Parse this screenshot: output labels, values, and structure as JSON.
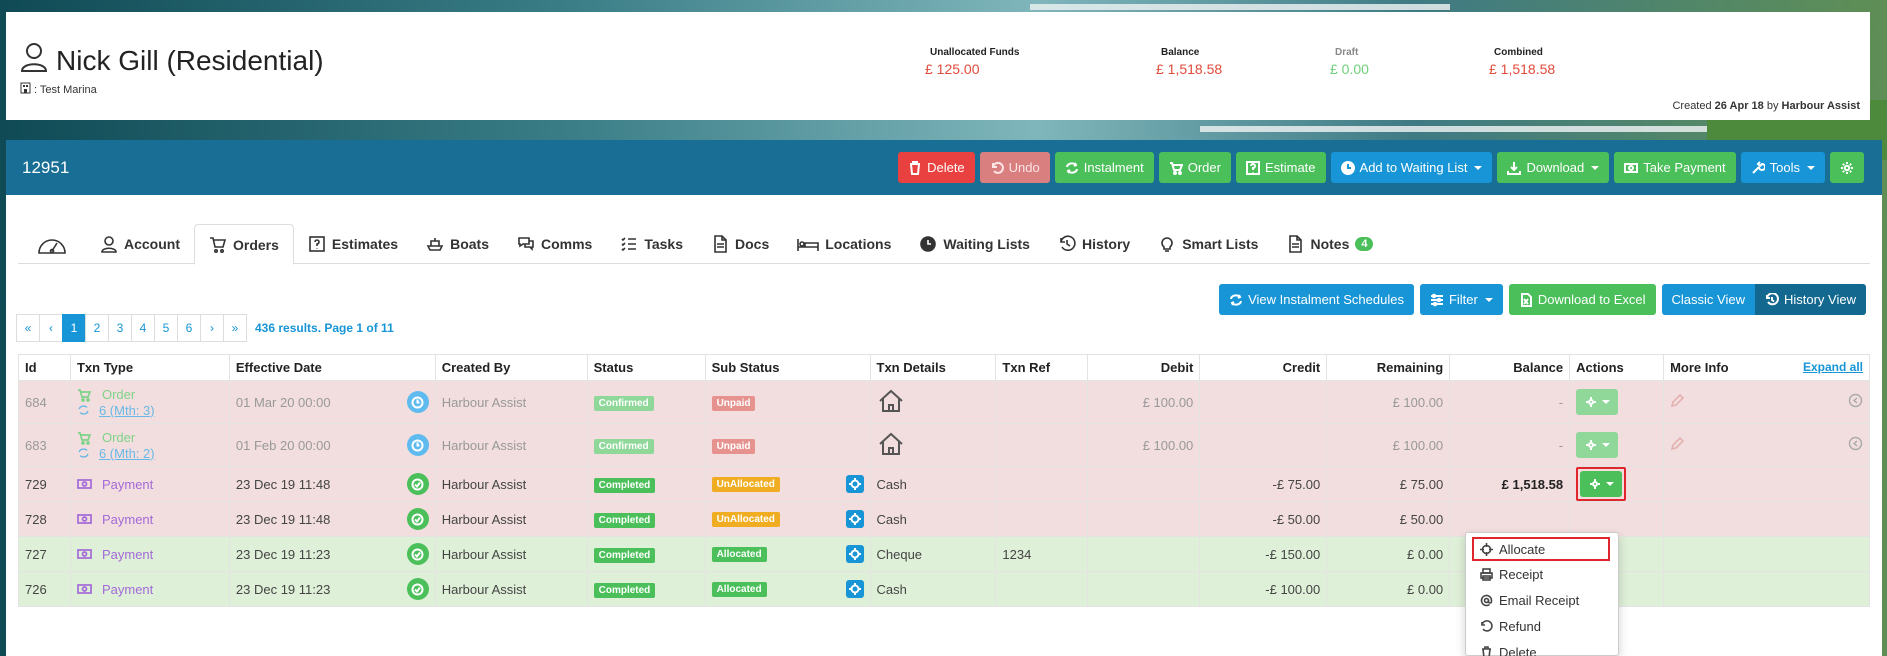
{
  "customer": {
    "name": "Nick Gill (Residential)",
    "marina": ": Test Marina",
    "created_prefix": "Created",
    "created_date": "26 Apr 18",
    "created_by_prefix": "by",
    "created_by": "Harbour Assist"
  },
  "funds": {
    "unallocated": {
      "label": "Unallocated Funds",
      "value": "£ 125.00"
    },
    "balance": {
      "label": "Balance",
      "value": "£ 1,518.58"
    },
    "draft": {
      "label": "Draft",
      "value": "£ 0.00"
    },
    "combined": {
      "label": "Combined",
      "value": "£ 1,518.58"
    }
  },
  "account_number": "12951",
  "toolbar": {
    "delete": "Delete",
    "undo": "Undo",
    "instalment": "Instalment",
    "order": "Order",
    "estimate": "Estimate",
    "waiting_list": "Add to Waiting List",
    "download": "Download",
    "take_payment": "Take Payment",
    "tools": "Tools"
  },
  "tabs": [
    "Account",
    "Orders",
    "Estimates",
    "Boats",
    "Comms",
    "Tasks",
    "Docs",
    "Locations",
    "Waiting Lists",
    "History",
    "Smart Lists",
    "Notes"
  ],
  "notes_badge": "4",
  "secondary": {
    "instalment_schedules": "View Instalment Schedules",
    "filter": "Filter",
    "download_excel": "Download to Excel",
    "classic_view": "Classic View",
    "history_view": "History View"
  },
  "pagination": {
    "first": "«",
    "prev": "‹",
    "pages": [
      "1",
      "2",
      "3",
      "4",
      "5",
      "6"
    ],
    "next": "›",
    "last": "»",
    "info": "436 results. Page 1 of 11"
  },
  "table": {
    "headers": {
      "id": "Id",
      "txn_type": "Txn Type",
      "effective_date": "Effective Date",
      "created_by": "Created By",
      "status": "Status",
      "sub_status": "Sub Status",
      "txn_details": "Txn Details",
      "txn_ref": "Txn Ref",
      "debit": "Debit",
      "credit": "Credit",
      "remaining": "Remaining",
      "balance": "Balance",
      "actions": "Actions",
      "more_info": "More Info",
      "expand_all": "Expand all"
    },
    "rows": [
      {
        "id": "684",
        "type": "Order",
        "sub": "6 (Mth: 3)",
        "date": "01 Mar 20 00:00",
        "created_by": "Harbour Assist",
        "status": "Confirmed",
        "sub_status": "Unpaid",
        "details": "",
        "ref": "",
        "debit": "£ 100.00",
        "credit": "",
        "remaining": "£ 100.00",
        "balance": "-"
      },
      {
        "id": "683",
        "type": "Order",
        "sub": "6 (Mth: 2)",
        "date": "01 Feb 20 00:00",
        "created_by": "Harbour Assist",
        "status": "Confirmed",
        "sub_status": "Unpaid",
        "details": "",
        "ref": "",
        "debit": "£ 100.00",
        "credit": "",
        "remaining": "£ 100.00",
        "balance": "-"
      },
      {
        "id": "729",
        "type": "Payment",
        "date": "23 Dec 19 11:48",
        "created_by": "Harbour Assist",
        "status": "Completed",
        "sub_status": "UnAllocated",
        "details": "Cash",
        "ref": "",
        "debit": "",
        "credit": "-£ 75.00",
        "remaining": "£ 75.00",
        "balance": "£ 1,518.58"
      },
      {
        "id": "728",
        "type": "Payment",
        "date": "23 Dec 19 11:48",
        "created_by": "Harbour Assist",
        "status": "Completed",
        "sub_status": "UnAllocated",
        "details": "Cash",
        "ref": "",
        "debit": "",
        "credit": "-£ 50.00",
        "remaining": "£ 50.00",
        "balance": ""
      },
      {
        "id": "727",
        "type": "Payment",
        "date": "23 Dec 19 11:23",
        "created_by": "Harbour Assist",
        "status": "Completed",
        "sub_status": "Allocated",
        "details": "Cheque",
        "ref": "1234",
        "debit": "",
        "credit": "-£ 150.00",
        "remaining": "£ 0.00",
        "balance": ""
      },
      {
        "id": "726",
        "type": "Payment",
        "date": "23 Dec 19 11:23",
        "created_by": "Harbour Assist",
        "status": "Completed",
        "sub_status": "Allocated",
        "details": "Cash",
        "ref": "",
        "debit": "",
        "credit": "-£ 100.00",
        "remaining": "£ 0.00",
        "balance": ""
      }
    ]
  },
  "dropdown": {
    "allocate": "Allocate",
    "receipt": "Receipt",
    "email_receipt": "Email Receipt",
    "refund": "Refund",
    "delete": "Delete"
  },
  "colors": {
    "primary_bar": "#186e94",
    "danger": "#e8413f",
    "success": "#4bbf5a",
    "info": "#1795d6",
    "highlight_outline": "#e0252b"
  }
}
